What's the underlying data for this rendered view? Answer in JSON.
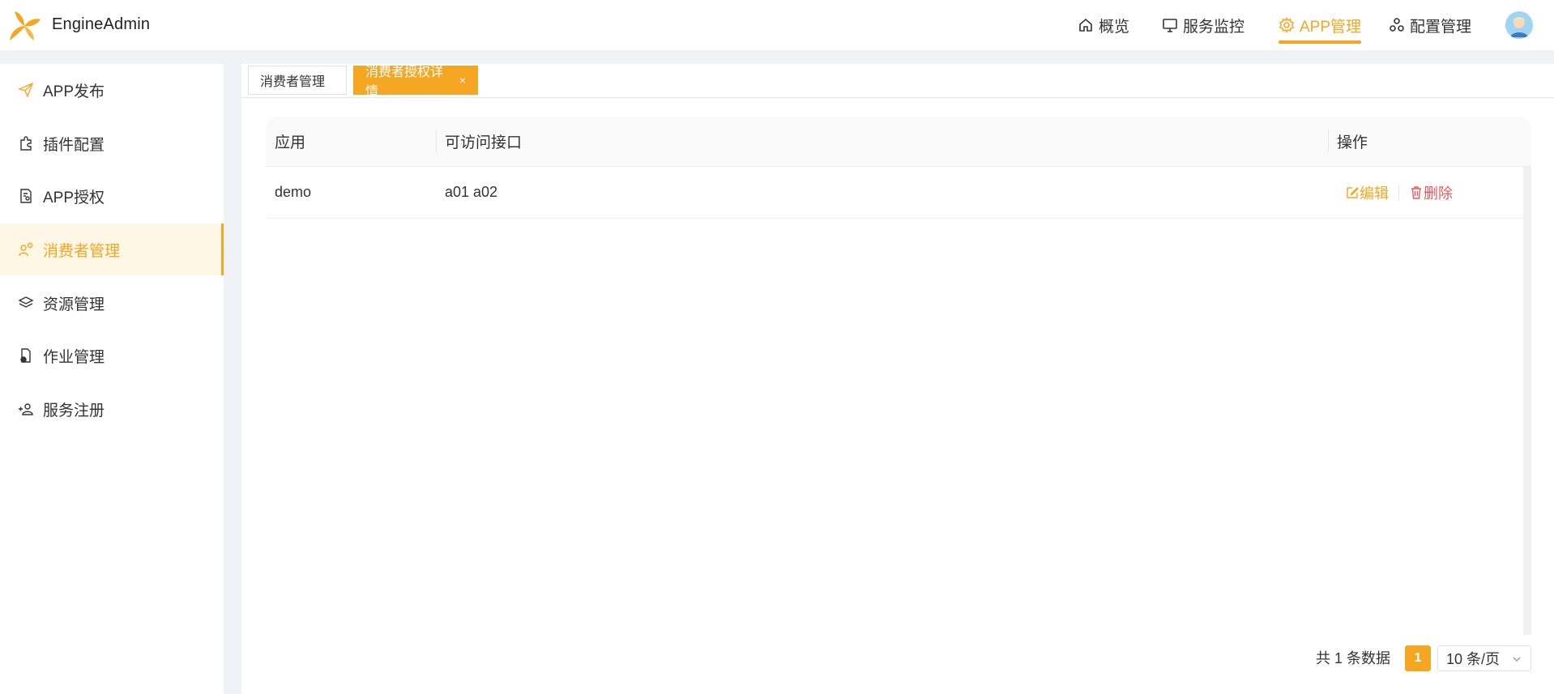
{
  "app": {
    "brand": "EngineAdmin",
    "accent": "#f5a623"
  },
  "topnav": {
    "items": [
      {
        "label": "概览",
        "icon": "home-icon"
      },
      {
        "label": "服务监控",
        "icon": "monitor-icon"
      },
      {
        "label": "APP管理",
        "icon": "gear-icon",
        "active": true
      },
      {
        "label": "配置管理",
        "icon": "cluster-icon"
      }
    ]
  },
  "sidebar": {
    "items": [
      {
        "label": "APP发布",
        "icon": "send-icon"
      },
      {
        "label": "插件配置",
        "icon": "puzzle-icon"
      },
      {
        "label": "APP授权",
        "icon": "document-key-icon"
      },
      {
        "label": "消费者管理",
        "icon": "user-gear-icon",
        "active": true
      },
      {
        "label": "资源管理",
        "icon": "layers-icon"
      },
      {
        "label": "作业管理",
        "icon": "file-lock-icon"
      },
      {
        "label": "服务注册",
        "icon": "user-add-icon"
      }
    ]
  },
  "tabs": [
    {
      "label": "消费者管理",
      "active": false
    },
    {
      "label": "消费者授权详情",
      "active": true,
      "close": "×"
    }
  ],
  "table": {
    "columns": [
      "应用",
      "可访问接口",
      "操作"
    ],
    "rows": [
      {
        "app": "demo",
        "apis": "a01 a02",
        "edit": "编辑",
        "delete": "删除"
      }
    ]
  },
  "pagination": {
    "total_text": "共 1 条数据",
    "current_page": "1",
    "page_size": "10 条/页"
  }
}
